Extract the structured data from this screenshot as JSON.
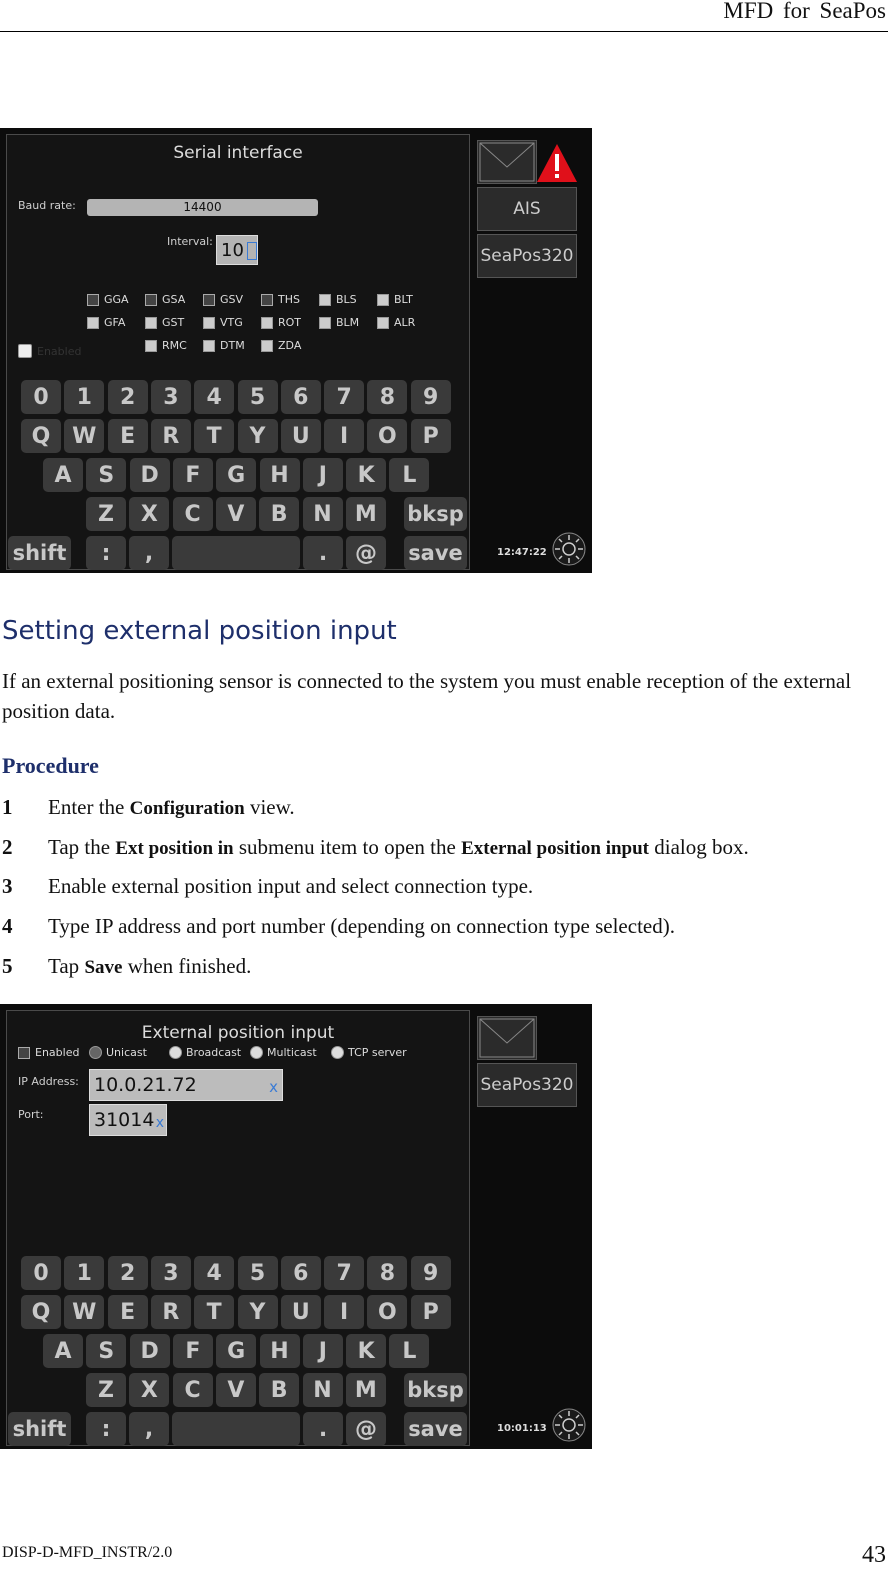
{
  "header": {
    "title": "MFD  for  SeaPos"
  },
  "shot1": {
    "title": "Serial interface",
    "baud_label": "Baud rate:",
    "baud_value": "14400",
    "interval_label": "Interval:",
    "interval_value": "10",
    "sentences": [
      "GGA",
      "GSA",
      "GSV",
      "THS",
      "BLS",
      "BLT",
      "GFA",
      "GST",
      "VTG",
      "ROT",
      "BLM",
      "ALR",
      "RMC",
      "DTM",
      "ZDA"
    ],
    "enabled_label": "Enabled",
    "side": {
      "ais": "AIS",
      "seapos": "SeaPos320"
    },
    "clock": "12:47:22"
  },
  "keyboard": {
    "row1": [
      "0",
      "1",
      "2",
      "3",
      "4",
      "5",
      "6",
      "7",
      "8",
      "9"
    ],
    "row2": [
      "Q",
      "W",
      "E",
      "R",
      "T",
      "Y",
      "U",
      "I",
      "O",
      "P"
    ],
    "row3": [
      "A",
      "S",
      "D",
      "F",
      "G",
      "H",
      "J",
      "K",
      "L"
    ],
    "row4": [
      "Z",
      "X",
      "C",
      "V",
      "B",
      "N",
      "M"
    ],
    "bksp": "bksp",
    "shift": "shift",
    "colon": ":",
    "comma": ",",
    "dot": ".",
    "at": "@",
    "save": "save"
  },
  "section": {
    "heading": "Setting external position input",
    "intro": "If an external positioning sensor is connected to the system you must enable reception of the external position data.",
    "procedure": "Procedure",
    "steps": [
      {
        "n": "1",
        "a": "Enter the ",
        "b": "Configuration",
        "c": " view."
      },
      {
        "n": "2",
        "a": "Tap the ",
        "b": "Ext position in",
        "c": " submenu item to open the ",
        "d": "External position input",
        "e": " dialog box."
      },
      {
        "n": "3",
        "a": "Enable external position input and select connection type."
      },
      {
        "n": "4",
        "a": "Type IP address and port number (depending on connection type selected)."
      },
      {
        "n": "5",
        "a": "Tap ",
        "b": "Save",
        "c": " when finished."
      }
    ]
  },
  "shot2": {
    "title": "External position input",
    "enabled": "Enabled",
    "unicast": "Unicast",
    "broadcast": "Broadcast",
    "multicast": "Multicast",
    "tcp": "TCP server",
    "ip_label": "IP Address:",
    "ip_value": "10.0.21.72",
    "port_label": "Port:",
    "port_value": "31014",
    "clear": "x",
    "side": {
      "seapos": "SeaPos320"
    },
    "clock": "10:01:13"
  },
  "footer": {
    "doc_id": "DISP-D-MFD_INSTR/2.0",
    "page": "43"
  }
}
